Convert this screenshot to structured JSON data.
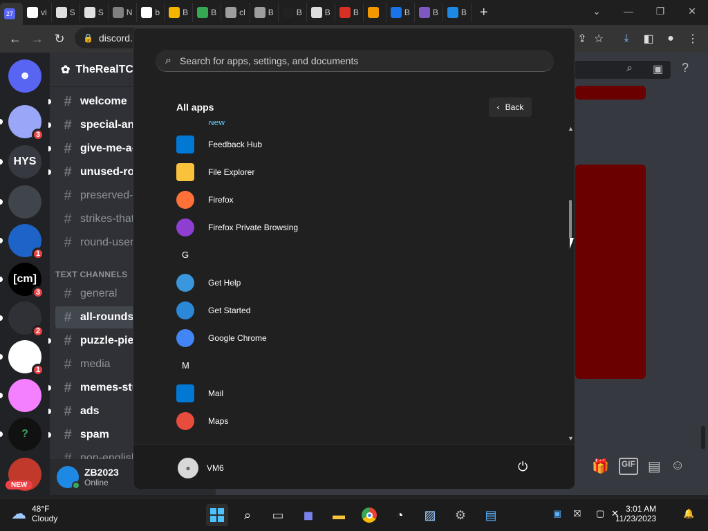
{
  "browser": {
    "tabs": [
      {
        "label": "",
        "badge": "27",
        "color": "#5865f2"
      },
      {
        "label": "vi",
        "color": "#ffffff"
      },
      {
        "label": "S",
        "color": "#e0e0e0"
      },
      {
        "label": "S",
        "color": "#e0e0e0"
      },
      {
        "label": "N",
        "color": "#808080"
      },
      {
        "label": "b",
        "color": "#ffffff"
      },
      {
        "label": "B",
        "color": "#f4b400"
      },
      {
        "label": "B",
        "color": "#34a853"
      },
      {
        "label": "cl",
        "color": "#9e9e9e"
      },
      {
        "label": "B",
        "color": "#9e9e9e"
      },
      {
        "label": "B",
        "color": "#222222"
      },
      {
        "label": "B",
        "color": "#dddddd"
      },
      {
        "label": "B",
        "color": "#d93025"
      },
      {
        "label": "",
        "color": "#f29900"
      },
      {
        "label": "B",
        "color": "#1a73e8"
      },
      {
        "label": "B",
        "color": "#7e57c2"
      },
      {
        "label": "B",
        "color": "#1e88e5"
      }
    ],
    "address": "discord."
  },
  "discord": {
    "server_name": "TheRealTC",
    "guilds": [
      {
        "label": "",
        "type": "home"
      },
      {
        "label": "",
        "badge": "3"
      },
      {
        "label": "HYS"
      },
      {
        "label": ""
      },
      {
        "label": "",
        "badge": "1"
      },
      {
        "label": "[cm]",
        "badge": "3"
      },
      {
        "label": "",
        "badge": "2"
      },
      {
        "label": "",
        "badge": "1"
      },
      {
        "label": ""
      },
      {
        "label": "?"
      },
      {
        "label": "",
        "new": "NEW"
      }
    ],
    "channels": [
      {
        "name": "welcome",
        "state": "unread"
      },
      {
        "name": "special-ann",
        "state": "unread"
      },
      {
        "name": "give-me-a-",
        "state": "unread"
      },
      {
        "name": "unused-rou",
        "state": "unread"
      },
      {
        "name": "preserved-",
        "state": "read"
      },
      {
        "name": "strikes-that",
        "state": "read"
      },
      {
        "name": "round-user",
        "state": "read"
      }
    ],
    "category": "TEXT CHANNELS",
    "text_channels": [
      {
        "name": "general",
        "state": "read"
      },
      {
        "name": "all-rounds",
        "state": "active"
      },
      {
        "name": "puzzle-piec",
        "state": "unread"
      },
      {
        "name": "media",
        "state": "read"
      },
      {
        "name": "memes-stu",
        "state": "unread"
      },
      {
        "name": "ads",
        "state": "unread"
      },
      {
        "name": "spam",
        "state": "unread"
      },
      {
        "name": "non-english",
        "state": "read"
      }
    ],
    "user": {
      "name": "ZB2023",
      "status": "Online"
    }
  },
  "start_menu": {
    "search_placeholder": "Search for apps, settings, and documents",
    "heading": "All apps",
    "back_label": "Back",
    "partial_label": "New",
    "entries": [
      {
        "kind": "app",
        "name": "Feedback Hub",
        "icon": "feedback-hub-icon",
        "color": "#0078d4"
      },
      {
        "kind": "app",
        "name": "File Explorer",
        "icon": "file-explorer-icon",
        "color": "#f9c23c"
      },
      {
        "kind": "app",
        "name": "Firefox",
        "icon": "firefox-icon",
        "color": "#ff7139"
      },
      {
        "kind": "app",
        "name": "Firefox Private Browsing",
        "icon": "firefox-private-icon",
        "color": "#8e3fd1"
      },
      {
        "kind": "letter",
        "name": "G"
      },
      {
        "kind": "app",
        "name": "Get Help",
        "icon": "get-help-icon",
        "color": "#3a96dd"
      },
      {
        "kind": "app",
        "name": "Get Started",
        "icon": "get-started-icon",
        "color": "#2b88d8"
      },
      {
        "kind": "app",
        "name": "Google Chrome",
        "icon": "chrome-icon",
        "color": "#4285f4"
      },
      {
        "kind": "letter",
        "name": "M"
      },
      {
        "kind": "app",
        "name": "Mail",
        "icon": "mail-icon",
        "color": "#0078d4"
      },
      {
        "kind": "app",
        "name": "Maps",
        "icon": "maps-icon",
        "color": "#e74c3c"
      }
    ],
    "account_name": "VM6"
  },
  "taskbar": {
    "weather_temp": "48°F",
    "weather_desc": "Cloudy",
    "time": "3:01 AM",
    "date": "11/23/2023"
  }
}
